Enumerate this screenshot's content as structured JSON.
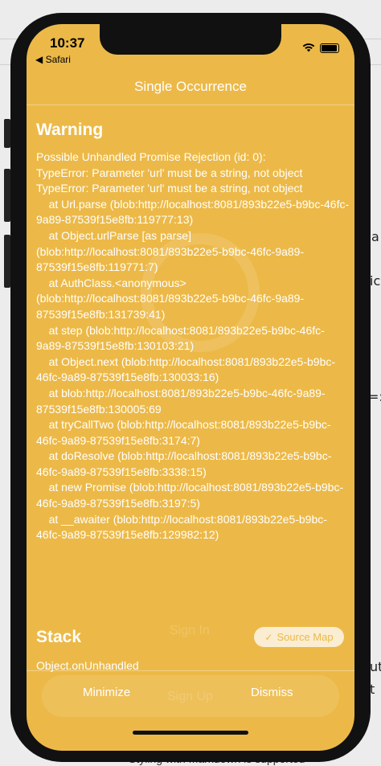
{
  "status_bar": {
    "time": "10:37",
    "back_app": "◀ Safari"
  },
  "header": {
    "title": "Single Occurrence"
  },
  "warning": {
    "title": "Warning",
    "message": "Possible Unhandled Promise Rejection (id: 0):\nTypeError: Parameter 'url' must be a string, not object\nTypeError: Parameter 'url' must be a string, not object\n    at Url.parse (blob:http://localhost:8081/893b22e5-b9bc-46fc-9a89-87539f15e8fb:119777:13)\n    at Object.urlParse [as parse] (blob:http://localhost:8081/893b22e5-b9bc-46fc-9a89-87539f15e8fb:119771:7)\n    at AuthClass.<anonymous> (blob:http://localhost:8081/893b22e5-b9bc-46fc-9a89-87539f15e8fb:131739:41)\n    at step (blob:http://localhost:8081/893b22e5-b9bc-46fc-9a89-87539f15e8fb:130103:21)\n    at Object.next (blob:http://localhost:8081/893b22e5-b9bc-46fc-9a89-87539f15e8fb:130033:16)\n    at blob:http://localhost:8081/893b22e5-b9bc-46fc-9a89-87539f15e8fb:130005:69\n    at tryCallTwo (blob:http://localhost:8081/893b22e5-b9bc-46fc-9a89-87539f15e8fb:3174:7)\n    at doResolve (blob:http://localhost:8081/893b22e5-b9bc-46fc-9a89-87539f15e8fb:3338:15)\n    at new Promise (blob:http://localhost:8081/893b22e5-b9bc-46fc-9a89-87539f15e8fb:3197:5)\n    at __awaiter (blob:http://localhost:8081/893b22e5-b9bc-46fc-9a89-87539f15e8fb:129982:12)"
  },
  "stack": {
    "title": "Stack",
    "source_map_label": "Source Map",
    "first_frame": "Object.onUnhandled"
  },
  "ghost": {
    "sign_in": "Sign In",
    "sign_up": "Sign Up"
  },
  "actions": {
    "minimize": "Minimize",
    "dismiss": "Dismiss"
  },
  "background": {
    "char_1": "a",
    "char_2": "ic",
    "char_3": "=:",
    "char_4": "ut",
    "char_5": "t",
    "bottom_text": "Styling with Markdown is supported"
  },
  "colors": {
    "overlay": "#ECB948",
    "text": "#FFFFFF",
    "device": "#111111"
  }
}
